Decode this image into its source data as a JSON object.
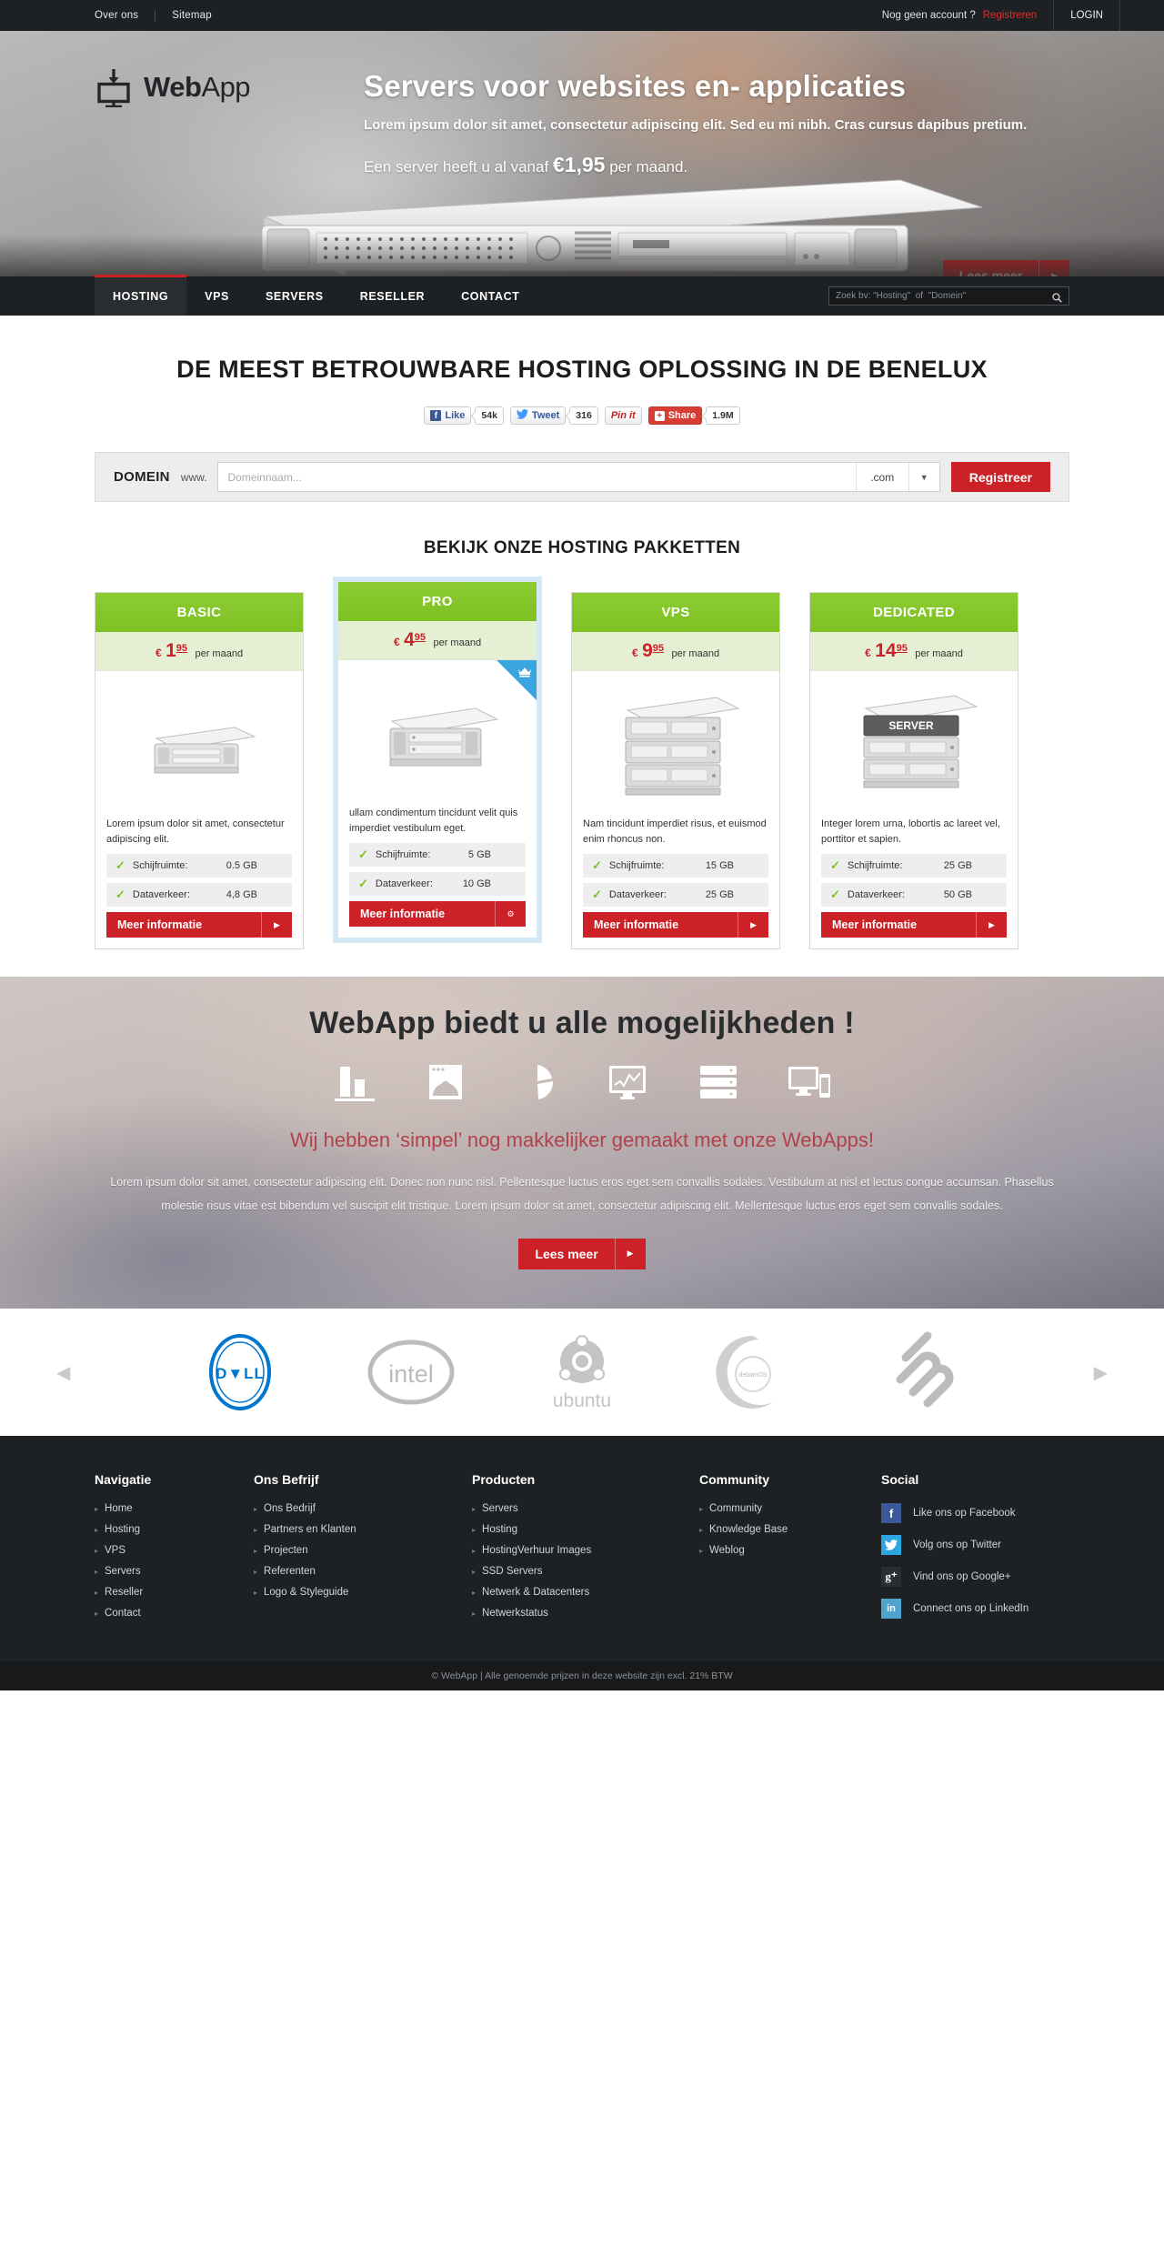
{
  "topbar": {
    "left_links": [
      "Over ons",
      "Sitemap"
    ],
    "no_account": "Nog geen account ?",
    "register": "Registreren",
    "login": "LOGIN"
  },
  "brand": {
    "name_bold": "Web",
    "name_light": "App",
    "logo_icon": "monitor-download-icon"
  },
  "hero": {
    "title": "Servers voor websites en- applicaties",
    "subtitle": "Lorem ipsum dolor sit amet, consectetur adipiscing elit. Sed eu mi nibh. Cras cursus dapibus pretium.",
    "price_prefix": "Een server heeft u al vanaf ",
    "price": "€1,95",
    "price_suffix": " per maand.",
    "cta": "Lees meer",
    "cta_arrow": "▶"
  },
  "nav": {
    "items": [
      "HOSTING",
      "VPS",
      "SERVERS",
      "RESELLER",
      "CONTACT"
    ],
    "active_index": 0,
    "search_placeholder": "Zoek bv: \"Hosting\"  of  \"Domein\"",
    "search_value": "",
    "search_icon": "search-icon"
  },
  "headline": "DE MEEST BETROUWBARE HOSTING OPLOSSING IN DE BENELUX",
  "social_buttons": [
    {
      "name": "facebook-like",
      "icon": "f",
      "label": "Like",
      "count": "54k"
    },
    {
      "name": "twitter-tweet",
      "icon": "🐦",
      "label": "Tweet",
      "count": "316"
    },
    {
      "name": "pinterest-pinit",
      "icon": "",
      "label": "Pin it",
      "count": ""
    },
    {
      "name": "google-share",
      "icon": "+",
      "label": "Share",
      "count": "1.9M"
    }
  ],
  "domain": {
    "label": "DOMEIN",
    "www": "www.",
    "placeholder": "Domeinnaam...",
    "value": "",
    "tld": ".com",
    "tld_arrow": "▼",
    "button": "Registreer"
  },
  "packages_heading": "BEKIJK ONZE HOSTING PAKKETTEN",
  "packages": [
    {
      "name": "BASIC",
      "currency": "€",
      "price_int": "1",
      "price_cents": "95",
      "per": "per maand",
      "desc": "Lorem ipsum dolor sit amet, consectetur adipiscing elit.",
      "server_icon": "server-1u-icon",
      "features": [
        {
          "label": "Schijfruimte:",
          "value": "0.5 GB"
        },
        {
          "label": "Dataverkeer:",
          "value": "4,8 GB"
        }
      ],
      "cta": "Meer informatie",
      "cta_icon": "▶",
      "featured": false
    },
    {
      "name": "PRO",
      "currency": "€",
      "price_int": "4",
      "price_cents": "95",
      "per": "per maand",
      "desc": "ullam condimentum tincidunt velit quis imperdiet vestibulum eget.",
      "server_icon": "server-2u-icon",
      "features": [
        {
          "label": "Schijfruimte:",
          "value": "5 GB"
        },
        {
          "label": "Dataverkeer:",
          "value": "10 GB"
        }
      ],
      "cta": "Meer informatie",
      "cta_icon": "⚙",
      "featured": true,
      "ribbon_icon": "crown-icon"
    },
    {
      "name": "VPS",
      "currency": "€",
      "price_int": "9",
      "price_cents": "95",
      "per": "per maand",
      "desc": "Nam tincidunt imperdiet risus, et euismod enim rhoncus non.",
      "server_icon": "server-rack-icon",
      "features": [
        {
          "label": "Schijfruimte:",
          "value": "15 GB"
        },
        {
          "label": "Dataverkeer:",
          "value": "25 GB"
        }
      ],
      "cta": "Meer informatie",
      "cta_icon": "▶",
      "featured": false
    },
    {
      "name": "DEDICATED",
      "currency": "€",
      "price_int": "14",
      "price_cents": "95",
      "per": "per maand",
      "desc": "Integer lorem urna, lobortis ac lareet vel, porttitor et sapien.",
      "server_icon": "server-stack-icon",
      "server_label": "SERVER",
      "features": [
        {
          "label": "Schijfruimte:",
          "value": "25 GB"
        },
        {
          "label": "Dataverkeer:",
          "value": "50 GB"
        }
      ],
      "cta": "Meer informatie",
      "cta_icon": "▶",
      "featured": false
    }
  ],
  "band": {
    "heading": "WebApp biedt u alle mogelijkheden !",
    "icons": [
      "bar-chart-icon",
      "browser-window-icon",
      "pie-chart-icon",
      "monitor-graph-icon",
      "server-rack-icon",
      "devices-icon"
    ],
    "subheading": "Wij hebben ‘simpel’ nog makkelijker gemaakt met onze WebApps!",
    "paragraph": "Lorem ipsum dolor sit amet, consectetur adipiscing elit. Donec non nunc nisl. Pellentesque luctus eros eget sem convallis sodales. Vestibulum at nisl et lectus congue accumsan. Phasellus molestie risus vitae est bibendum vel suscipit elit tristique. Lorem ipsum dolor sit amet, consectetur adipiscing elit. Mellentesque luctus eros eget sem convallis sodales.",
    "cta": "Lees meer",
    "cta_arrow": "▶"
  },
  "brands": {
    "prev_icon": "◀",
    "next_icon": "▶",
    "items": [
      "DELL",
      "intel",
      "ubuntu",
      "debianOS",
      "squarespace"
    ]
  },
  "footer": {
    "columns": [
      {
        "title": "Navigatie",
        "links": [
          "Home",
          "Hosting",
          "VPS",
          "Servers",
          "Reseller",
          "Contact"
        ]
      },
      {
        "title": "Ons Befrijf",
        "links": [
          "Ons Bedrijf",
          "Partners en Klanten",
          "Projecten",
          "Referenten",
          "Logo & Styleguide"
        ]
      },
      {
        "title": "Producten",
        "links": [
          "Servers",
          "Hosting",
          "HostingVerhuur Images",
          "SSD Servers",
          "Netwerk & Datacenters",
          "Netwerkstatus"
        ]
      },
      {
        "title": "Community",
        "links": [
          "Community",
          "Knowledge Base",
          "Weblog"
        ]
      }
    ],
    "social_title": "Social",
    "social": [
      {
        "icon": "facebook-icon",
        "glyph": "f",
        "label": "Like ons op Facebook",
        "color": "#3b5998"
      },
      {
        "icon": "twitter-icon",
        "glyph": "🐦",
        "label": "Volg ons op Twitter",
        "color": "#2da5e0"
      },
      {
        "icon": "google-plus-icon",
        "glyph": "g⁺",
        "label": "Vind ons op Google+",
        "color": "#2b2e31"
      },
      {
        "icon": "linkedin-icon",
        "glyph": "in",
        "label": "Connect ons op LinkedIn",
        "color": "#4fa3cc"
      }
    ],
    "caret": "▸",
    "copyright": "© WebApp | Alle genoemde prijzen in deze website zijn excl. 21% BTW"
  },
  "colors": {
    "red": "#cc2127",
    "green": "#7ec122",
    "blue": "#3aa6e0",
    "dark": "#1e2124"
  }
}
